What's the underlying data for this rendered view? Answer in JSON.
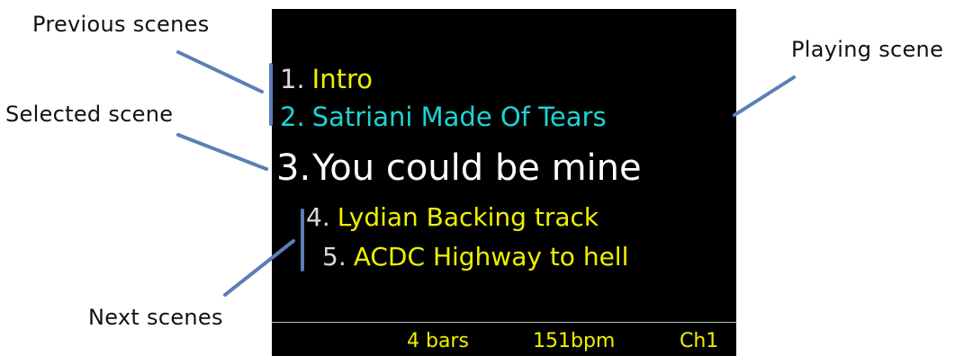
{
  "screen": {
    "scenes": [
      {
        "number": "1.",
        "title": "Intro",
        "state": "previous"
      },
      {
        "number": "2.",
        "title": "Satriani Made Of Tears",
        "state": "previous-playing"
      },
      {
        "number": "3.",
        "title": "You could be mine",
        "state": "selected"
      },
      {
        "number": "4.",
        "title": "Lydian Backing track",
        "state": "next"
      },
      {
        "number": "5.",
        "title": "ACDC Highway to hell",
        "state": "next"
      }
    ],
    "status_bar": {
      "bars": "4 bars",
      "tempo": "151bpm",
      "channel": "Ch1"
    }
  },
  "callouts": {
    "previous_scenes": "Previous scenes",
    "selected_scene": "Selected scene",
    "next_scenes": "Next scenes",
    "playing_scene": "Playing scene"
  },
  "colors": {
    "screen_background": "#000000",
    "scene_title": "#f0f000",
    "playing_scene": "#1fd3d3",
    "selected_scene": "#ffffff",
    "scene_number": "#d9d9d9",
    "callout_line": "#5b7fb5"
  }
}
